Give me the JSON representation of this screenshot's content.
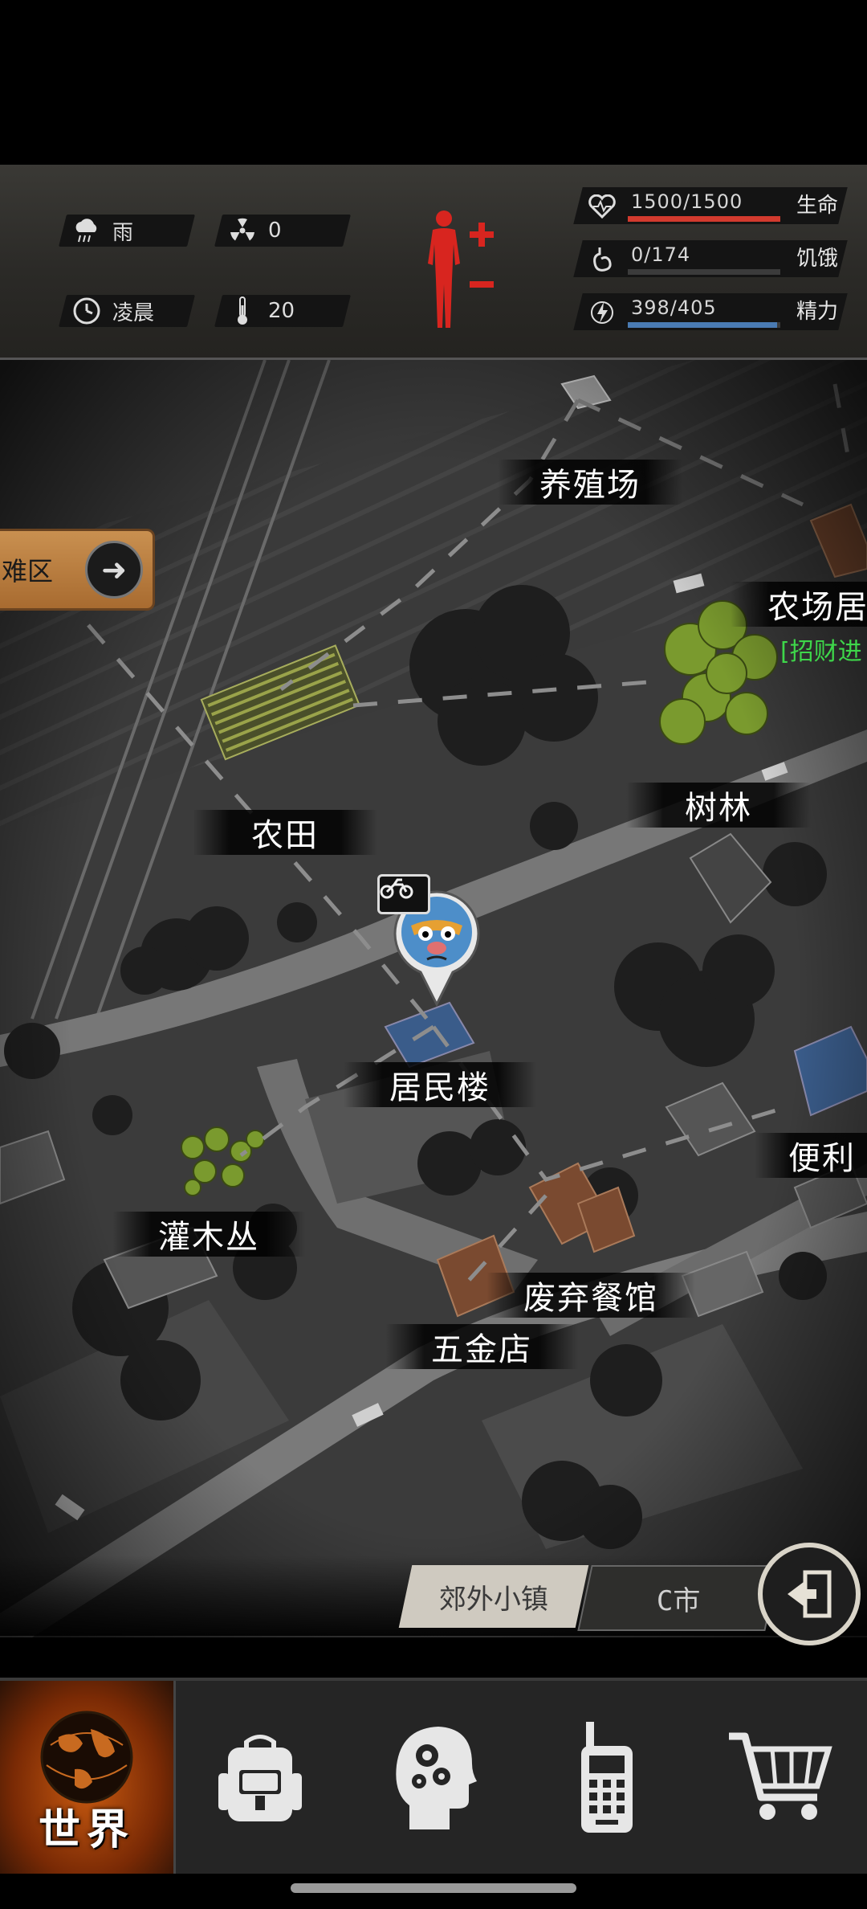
{
  "status": {
    "weather": {
      "icon": "rain-cloud-icon",
      "value": "雨"
    },
    "radiation": {
      "icon": "radiation-icon",
      "value": "0"
    },
    "time_of_day": {
      "icon": "clock-icon",
      "value": "凌晨"
    },
    "temperature": {
      "icon": "thermometer-icon",
      "value": "20"
    },
    "vitals": [
      {
        "label": "生命",
        "value": "1500/1500",
        "fraction": 1.0,
        "color": "#d23a2e",
        "icon": "heart-icon"
      },
      {
        "label": "饥饿",
        "value": "0/174",
        "fraction": 0.0,
        "color": "#8a8a8a",
        "icon": "stomach-icon"
      },
      {
        "label": "精力",
        "value": "398/405",
        "fraction": 0.98,
        "color": "#4a7bb3",
        "icon": "lightning-icon"
      }
    ]
  },
  "map": {
    "shelter_button": "难区",
    "locations": {
      "farm_breed": "养殖场",
      "farm_house": "农场居",
      "farm_house_sub": "[招财进",
      "field": "农田",
      "grove": "树林",
      "residential": "居民楼",
      "convenience": "便利",
      "bushes": "灌木丛",
      "restaurant": "废弃餐馆",
      "hardware": "五金店"
    }
  },
  "regions": {
    "active": "郊外小镇",
    "inactive": "C市"
  },
  "nav": {
    "world": "世界"
  }
}
